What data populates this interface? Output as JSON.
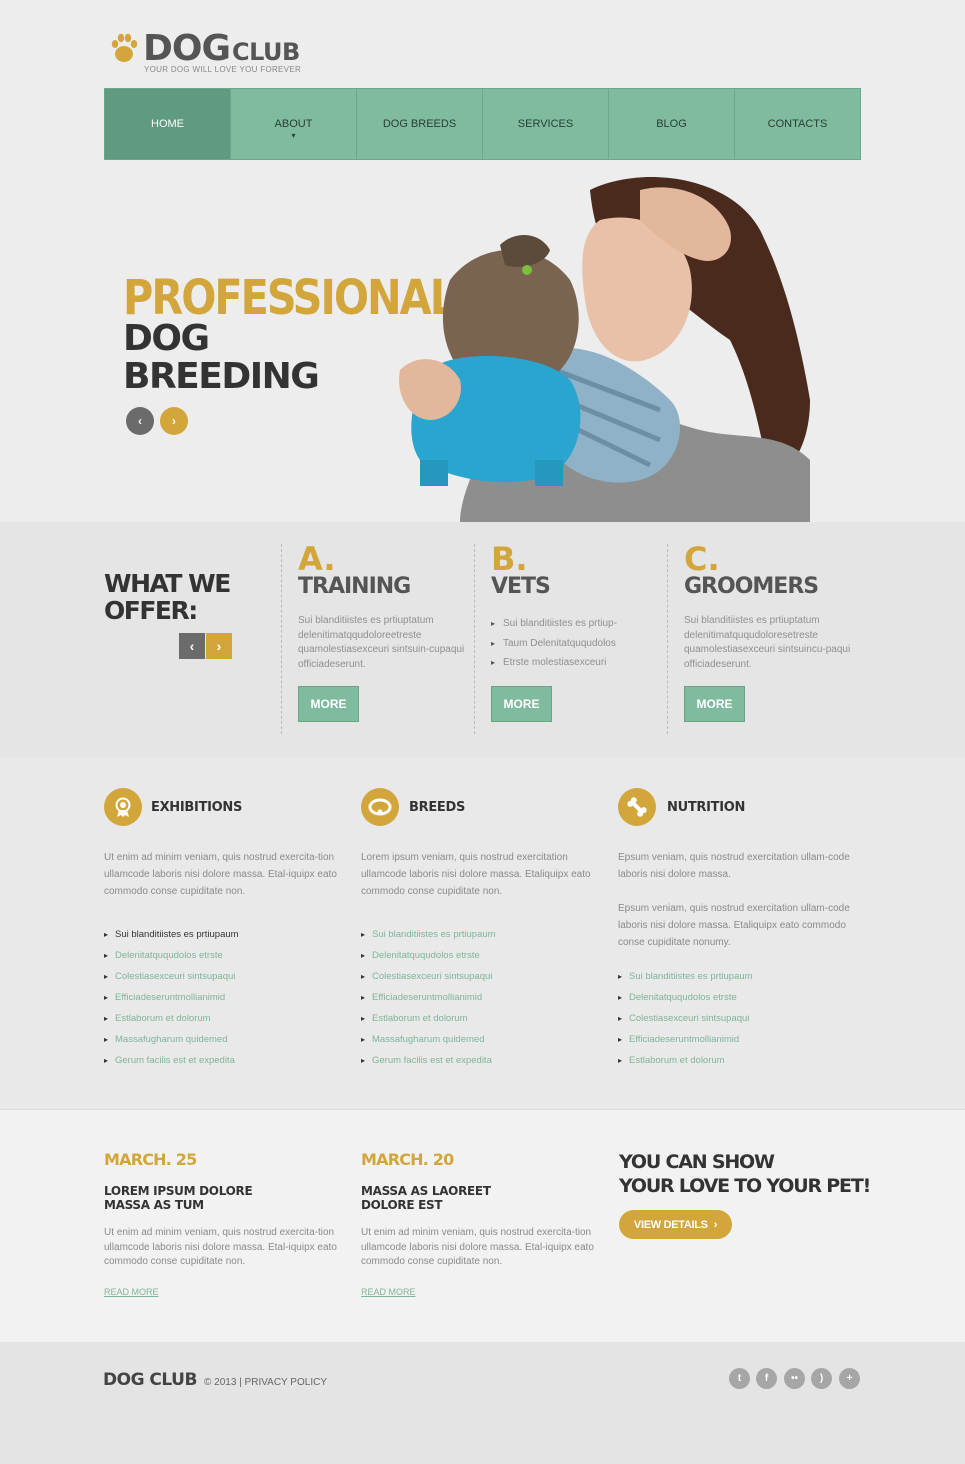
{
  "brand": {
    "name_dog": "DOG",
    "name_club": "CLUB",
    "tagline": "YOUR DOG WILL LOVE YOU FOREVER"
  },
  "nav": {
    "items": [
      "HOME",
      "ABOUT",
      "DOG BREEDS",
      "SERVICES",
      "BLOG",
      "CONTACTS"
    ],
    "active": "HOME"
  },
  "slider": {
    "line1": "PROFESSIONAL",
    "line2": "DOG",
    "line3": "BREEDING"
  },
  "offer": {
    "title_line1": "WHAT WE",
    "title_line2": "OFFER:",
    "columns": [
      {
        "letter": "A.",
        "name": "TRAINING",
        "text": "Sui blanditiistes es prtiuptatum delenitimatqqudoloreetreste quamolestiasexceuri sintsuin-cupaqui officiadeserunt.",
        "button": "MORE"
      },
      {
        "letter": "B.",
        "name": "VETS",
        "list": [
          "Sui blanditiistes es prtiup-",
          "Taum Delenitatququdolos",
          "Etrste molestiasexceuri"
        ],
        "button": "MORE"
      },
      {
        "letter": "C.",
        "name": "GROOMERS",
        "text": "Sui blanditiistes es prtiuptatum delenitimatququdoloresetreste quamolestiasexceuri sintsuincu-paqui officiadeserunt.",
        "button": "MORE"
      }
    ]
  },
  "features": [
    {
      "icon": "medal-icon",
      "title": "EXHIBITIONS",
      "text": "Ut enim ad minim veniam, quis nostrud exercita-tion ullamcode laboris nisi dolore massa. Etal-iquipx eato commodo conse cupiditate non.",
      "list": [
        "Sui blanditiistes es prtiupaum",
        "Delenitatququdolos etrste",
        "Colestiasexceuri sintsupaqui",
        "Efficiadeseruntmollianimid",
        "Estlaborum et dolorum",
        "Massafugharum quidemed",
        "Gerum facilis est et expedita"
      ]
    },
    {
      "icon": "collar-icon",
      "title": "BREEDS",
      "text": "Lorem ipsum veniam, quis nostrud exercitation ullamcode laboris nisi dolore massa. Etaliquipx eato commodo conse cupiditate non.",
      "list": [
        "Sui blanditiistes es prtiupaum",
        "Delenitatququdolos etrste",
        "Colestiasexceuri sintsupaqui",
        "Efficiadeseruntmollianimid",
        "Estlaborum et dolorum",
        "Massafugharum quidemed",
        "Gerum facilis est et expedita"
      ]
    },
    {
      "icon": "bone-icon",
      "title": "NUTRITION",
      "text": "Epsum veniam, quis nostrud exercitation ullam-code laboris nisi dolore massa.",
      "text2": "Epsum veniam, quis nostrud exercitation ullam-code laboris nisi dolore massa. Etaliquipx eato commodo conse cupiditate nonumy.",
      "list": [
        "Sui blanditiistes es prtiupaum",
        "Delenitatququdolos etrste",
        "Colestiasexceuri sintsupaqui",
        "Efficiadeseruntmollianimid",
        "Estlaborum et dolorum"
      ]
    }
  ],
  "news": [
    {
      "date": "MARCH. 25",
      "title_line1": "LOREM IPSUM DOLORE",
      "title_line2": "MASSA AS TUM",
      "text": "Ut enim ad minim veniam, quis nostrud exercita-tion ullamcode laboris nisi dolore massa. Etal-iquipx eato commodo conse cupiditate non.",
      "link": "READ MORE"
    },
    {
      "date": "MARCH. 20",
      "title_line1": "MASSA AS LAOREET",
      "title_line2": "DOLORE EST",
      "text": "Ut enim ad minim veniam, quis nostrud exercita-tion ullamcode laboris nisi dolore massa. Etal-iquipx eato commodo conse cupiditate non.",
      "link": "READ MORE"
    }
  ],
  "promo": {
    "line1": "YOU CAN SHOW",
    "line2": "YOUR LOVE TO YOUR PET!",
    "button": "VIEW DETAILS"
  },
  "footer": {
    "brand": "DOG CLUB",
    "copyright": "© 2013 | PRIVACY POLICY",
    "social": [
      "twitter-icon",
      "facebook-icon",
      "flickr-icon",
      "rss-icon",
      "plus-icon"
    ]
  },
  "colors": {
    "accent": "#d3a63c",
    "nav_green": "#7fbc9f",
    "nav_active": "#5f9b80",
    "link_green": "#7fb49a"
  }
}
